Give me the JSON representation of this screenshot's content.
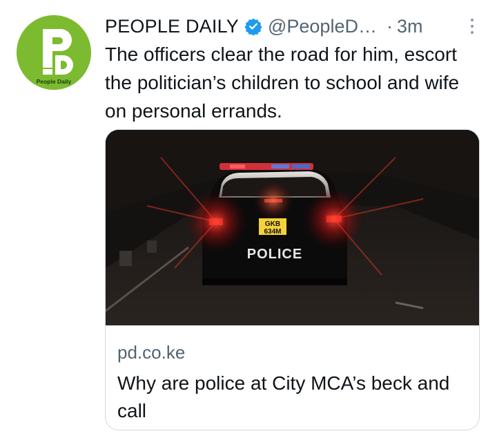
{
  "tweet": {
    "author_name": "PEOPLE DAILY",
    "handle": "@PeopleD…",
    "separator": "·",
    "timestamp": "3m",
    "text": "The officers clear the road for him, escort the politician’s children to school and wife on personal errands.",
    "avatar": {
      "logo_letters": "PD",
      "logo_caption": "People Daily",
      "brand_color": "#7cbb2f"
    },
    "verified_icon": "verified-badge-icon",
    "more_icon": "vertical-ellipsis-icon"
  },
  "card": {
    "image_description_icon": "police-car-photo",
    "image_text": {
      "plate_line1": "GKB",
      "plate_line2": "634M",
      "police_label": "POLICE"
    },
    "domain": "pd.co.ke",
    "title": "Why are police at City MCA’s beck and call"
  },
  "colors": {
    "text_primary": "#0f1419",
    "text_secondary": "#536471",
    "verified_blue": "#1d9bf0",
    "card_border": "#cfd9de"
  }
}
